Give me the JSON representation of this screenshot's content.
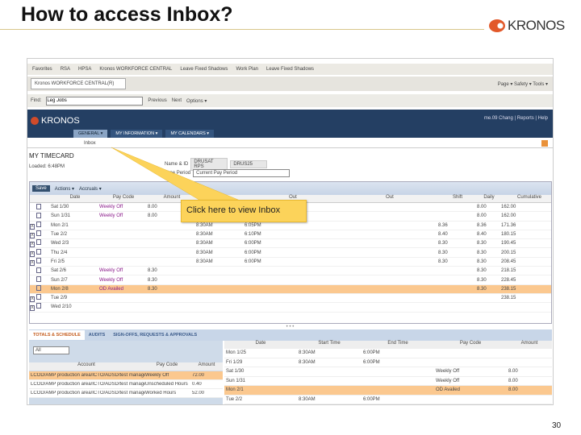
{
  "slide": {
    "title": "How to access Inbox?",
    "logo": "KRONOS",
    "page_number": "30"
  },
  "browser": {
    "favorites": [
      "Favorites",
      "RSA",
      "HPSA",
      "Kronos WORKFORCE CENTRAL",
      "Leave Fixed Shadows",
      "Work Plan",
      "Leave Fixed Shadows"
    ],
    "tab_title": "Kronos WORKFORCE CENTRAL(R)",
    "right_tools": "Page ▾  Safety ▾  Tools ▾",
    "find_label": "Find:",
    "find_value": "Leg Jobs",
    "find_prev": "Previous",
    "find_next": "Next",
    "find_options": "Options ▾"
  },
  "kronos": {
    "logo": "KRONOS",
    "user": "me.09 Chang | Reports | Help",
    "tabs": [
      "GENERAL ▾",
      "MY INFORMATION ▾",
      "MY CALENDARS ▾"
    ],
    "subnav": "Inbox"
  },
  "timecard": {
    "title": "MY TIMECARD",
    "loaded": "Loaded: 6:48PM",
    "name_label": "Name & ID",
    "name_value": "DRUSAT RPS",
    "id_value": "DRUS25",
    "tp_label": "Time Period",
    "tp_value": "Current Pay Period",
    "toolbar": {
      "save": "Save",
      "actions": "Actions ▾",
      "accruals": "Accruals ▾"
    },
    "columns": [
      "",
      "Date",
      "Pay Code",
      "Amount",
      "In",
      "Out",
      "Out",
      "Shift",
      "Daily",
      "Cumulative"
    ],
    "rows": [
      [
        "",
        "Sat 1/30",
        "Weekly Off",
        "8.00",
        "",
        "",
        "",
        "",
        "8.00",
        "162.00"
      ],
      [
        "",
        "Sun 1/31",
        "Weekly Off",
        "8.00",
        "",
        "",
        "",
        "",
        "8.00",
        "162.00"
      ],
      [
        "X",
        "Mon 2/1",
        "",
        "",
        "8:30AM",
        "6:05PM",
        "",
        "8.36",
        "8.36",
        "171.36"
      ],
      [
        "X",
        "Tue 2/2",
        "",
        "",
        "8:30AM",
        "6:10PM",
        "",
        "8.40",
        "8.40",
        "180.15"
      ],
      [
        "X",
        "Wed 2/3",
        "",
        "",
        "8:30AM",
        "6:00PM",
        "",
        "8.30",
        "8.30",
        "190.45"
      ],
      [
        "X",
        "Thu 2/4",
        "",
        "",
        "8:30AM",
        "6:00PM",
        "",
        "8.30",
        "8.30",
        "200.15"
      ],
      [
        "X",
        "Fri 2/5",
        "",
        "",
        "8:30AM",
        "6:00PM",
        "",
        "8.30",
        "8.30",
        "208.45"
      ],
      [
        "",
        "Sat 2/6",
        "Weekly Off",
        "8.30",
        "",
        "",
        "",
        "",
        "8.30",
        "218.15"
      ],
      [
        "",
        "Sun 2/7",
        "Weekly Off",
        "8.30",
        "",
        "",
        "",
        "",
        "8.30",
        "228.45"
      ],
      [
        "",
        "Mon 2/8",
        "OD Availed",
        "8.30",
        "",
        "",
        "",
        "",
        "8.30",
        "238.15"
      ],
      [
        "X",
        "Tue 2/9",
        "",
        "",
        "",
        "",
        "",
        "",
        "",
        "238.15"
      ],
      [
        "X",
        "Wed 2/10",
        "",
        "",
        "",
        "",
        "",
        "",
        "",
        ""
      ]
    ],
    "highlight_row": 9
  },
  "bottom": {
    "tabs": [
      "TOTALS & SCHEDULE",
      "AUDITS",
      "SIGN-OFFS, REQUESTS & APPROVALS"
    ],
    "filter": "All",
    "left_columns": [
      "Account",
      "Pay Code",
      "Amount"
    ],
    "left_rows": [
      [
        "LCOD/AMP production area/ICTO/ADSD/test manager",
        "Weekly Off",
        "72.00"
      ],
      [
        "LCOD/AMP production area/ICTO/ADSD/test manager",
        "Unscheduled Hours",
        "0.40"
      ],
      [
        "LCOD/AMP production area/ICTO/ADSD/test manager",
        "Worked Hours",
        "52.00"
      ]
    ],
    "right_columns": [
      "Date",
      "Start Time",
      "End Time",
      "Pay Code",
      "Amount"
    ],
    "right_rows": [
      [
        "Mon 1/25",
        "8:30AM",
        "6:00PM",
        "",
        ""
      ],
      [
        "Fri 1/29",
        "8:30AM",
        "6:00PM",
        "",
        ""
      ],
      [
        "Sat 1/30",
        "",
        "",
        "Weekly Off",
        "8.00"
      ],
      [
        "Sun 1/31",
        "",
        "",
        "Weekly Off",
        "8.00"
      ],
      [
        "Mon 2/1",
        "",
        "",
        "OD Availed",
        "8.00"
      ],
      [
        "Tue 2/2",
        "8:30AM",
        "6:00PM",
        "",
        ""
      ]
    ]
  },
  "callout": {
    "text": "Click here to view Inbox"
  }
}
